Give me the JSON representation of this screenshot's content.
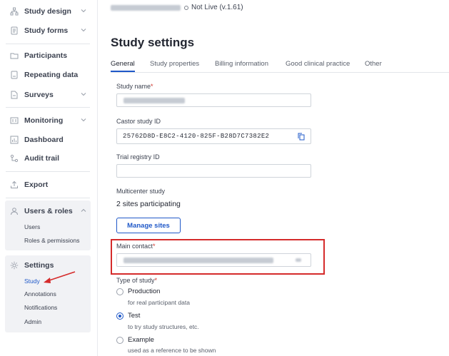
{
  "sidebar": {
    "items": [
      {
        "label": "Study design",
        "icon": "diagram-icon",
        "has_chevron": true
      },
      {
        "label": "Study forms",
        "icon": "form-icon",
        "has_chevron": true
      },
      {
        "label": "Participants",
        "icon": "folder-icon",
        "has_chevron": false
      },
      {
        "label": "Repeating data",
        "icon": "repeat-doc-icon",
        "has_chevron": false
      },
      {
        "label": "Surveys",
        "icon": "survey-icon",
        "has_chevron": true
      },
      {
        "label": "Monitoring",
        "icon": "monitor-icon",
        "has_chevron": true
      },
      {
        "label": "Dashboard",
        "icon": "dashboard-icon",
        "has_chevron": false
      },
      {
        "label": "Audit trail",
        "icon": "audit-icon",
        "has_chevron": false
      },
      {
        "label": "Export",
        "icon": "export-icon",
        "has_chevron": false
      }
    ],
    "users_roles": {
      "label": "Users & roles",
      "icon": "user-icon",
      "subitems": [
        "Users",
        "Roles & permissions"
      ]
    },
    "settings": {
      "label": "Settings",
      "icon": "gear-icon",
      "subitems": [
        "Study",
        "Annotations",
        "Notifications",
        "Admin"
      ],
      "active": "Study"
    }
  },
  "header": {
    "status": "Not Live (v.1.61)"
  },
  "page": {
    "title": "Study settings",
    "tabs": [
      "General",
      "Study properties",
      "Billing information",
      "Good clinical practice",
      "Other"
    ],
    "active_tab": "General"
  },
  "form": {
    "study_name_label": "Study name",
    "castor_id_label": "Castor study ID",
    "castor_id_value": "25762D8D-E8C2-4120-825F-B28D7C7382E2",
    "trial_registry_label": "Trial registry ID",
    "multicenter_label": "Multicenter study",
    "sites_text": "2 sites participating",
    "manage_sites_label": "Manage sites",
    "main_contact_label": "Main contact",
    "type_label": "Type of study",
    "required_mark": "*",
    "study_types": [
      {
        "label": "Production",
        "desc": "for real participant data",
        "checked": false
      },
      {
        "label": "Test",
        "desc": "to try study structures, etc.",
        "checked": true
      },
      {
        "label": "Example",
        "desc": "used as a reference to be shown",
        "checked": false
      }
    ]
  },
  "colors": {
    "accent": "#1f58c8",
    "highlight": "#d52b2b",
    "required": "#d0342c"
  }
}
